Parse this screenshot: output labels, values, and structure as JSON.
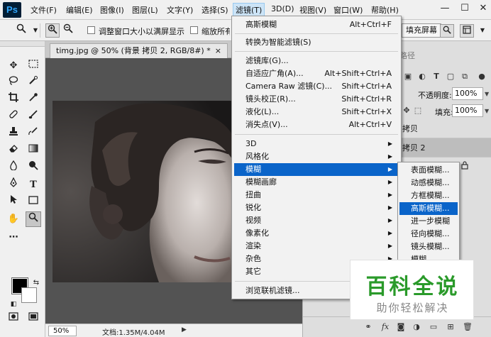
{
  "app": {
    "logo": "Ps"
  },
  "menubar": {
    "items": [
      "文件(F)",
      "编辑(E)",
      "图像(I)",
      "图层(L)",
      "文字(Y)",
      "选择(S)",
      "滤镜(T)",
      "3D(D)",
      "视图(V)",
      "窗口(W)",
      "帮助(H)"
    ],
    "active_index": 6
  },
  "window_controls": {
    "minimize": "—",
    "maximize": "☐",
    "close": "✕"
  },
  "options_bar": {
    "tool_icon": "zoom-icon",
    "resize_windows_label": "调整窗口大小以满屏显示",
    "zoom_all_label": "缩放所有",
    "fill_screen_label": "填充屏幕"
  },
  "document": {
    "tab_title": "timg.jpg @ 50% (背景 拷贝 2, RGB/8#) *",
    "close_glyph": "×",
    "zoom": "50%",
    "info": "文档:1.35M/4.04M",
    "status_arrow": "▶"
  },
  "right_panel": {
    "tab_label": "路径",
    "opacity_label": "不透明度:",
    "opacity_value": "100%",
    "fill_label": "填充:",
    "fill_value": "100%",
    "layers": [
      {
        "name": "拷贝",
        "selected": false
      },
      {
        "name": "拷贝 2",
        "selected": true
      }
    ],
    "lock_icon": "lock-icon"
  },
  "filter_menu": {
    "title": "滤镜(T)",
    "groups": [
      [
        {
          "label": "高斯模糊",
          "shortcut": "Alt+Ctrl+F"
        }
      ],
      [
        {
          "label": "转换为智能滤镜(S)",
          "shortcut": ""
        }
      ],
      [
        {
          "label": "滤镜库(G)...",
          "shortcut": ""
        },
        {
          "label": "自适应广角(A)...",
          "shortcut": "Alt+Shift+Ctrl+A"
        },
        {
          "label": "Camera Raw 滤镜(C)...",
          "shortcut": "Shift+Ctrl+A"
        },
        {
          "label": "镜头校正(R)...",
          "shortcut": "Shift+Ctrl+R"
        },
        {
          "label": "液化(L)...",
          "shortcut": "Shift+Ctrl+X"
        },
        {
          "label": "消失点(V)...",
          "shortcut": "Alt+Ctrl+V"
        }
      ],
      [
        {
          "label": "3D",
          "submenu": true
        },
        {
          "label": "风格化",
          "submenu": true
        },
        {
          "label": "模糊",
          "submenu": true,
          "highlight": true
        },
        {
          "label": "模糊画廊",
          "submenu": true
        },
        {
          "label": "扭曲",
          "submenu": true
        },
        {
          "label": "锐化",
          "submenu": true
        },
        {
          "label": "视频",
          "submenu": true
        },
        {
          "label": "像素化",
          "submenu": true
        },
        {
          "label": "渲染",
          "submenu": true
        },
        {
          "label": "杂色",
          "submenu": true
        },
        {
          "label": "其它",
          "submenu": true
        }
      ],
      [
        {
          "label": "浏览联机滤镜...",
          "shortcut": ""
        }
      ]
    ]
  },
  "blur_submenu": {
    "items": [
      "表面模糊...",
      "动感模糊...",
      "方框模糊...",
      "高斯模糊...",
      "进一步模糊",
      "径向模糊...",
      "镜头模糊...",
      "模糊"
    ],
    "highlight_index": 3
  },
  "watermark": {
    "title": "百科全说",
    "subtitle": "助你轻松解决"
  },
  "colors": {
    "accent_highlight": "#0a64c9",
    "menu_bg": "#f2f2f2",
    "workspace_bg": "#535353",
    "watermark_green": "#2a9a2a"
  }
}
